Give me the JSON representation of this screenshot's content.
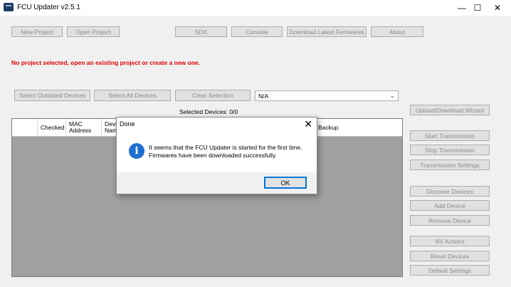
{
  "window": {
    "title": "FCU Updater v2.5.1",
    "minimize": "—",
    "maximize": "☐",
    "close": "✕"
  },
  "toolbar": {
    "new_project": "New Project",
    "open_project": "Open Project",
    "sdx": "SDX",
    "console": "Console",
    "download_firmwares": "Download Latest Firmwares",
    "about": "About"
  },
  "warning": "No project selected, open an existing project or create a new one.",
  "device_controls": {
    "select_outdated": "Select Outdated Devices",
    "select_all": "Select All Devices",
    "clear_selection": "Clear Selection",
    "dropdown_value": "N/A",
    "selected_devices": "Selected Devices: 0/0"
  },
  "table": {
    "headers": {
      "checked": "Checked",
      "mac_line1": "MAC",
      "mac_line2": "Address",
      "device_line1": "Devi",
      "device_line2": "Nam",
      "backup": "Backup"
    }
  },
  "right_panel": {
    "upload_wizard": "Upload/Download Wizard",
    "start_transmission": "Start Transmission",
    "stop_transmission": "Stop Transmission",
    "transmission_settings": "Transmission Settings",
    "discover_devices": "Discover Devices",
    "add_device": "Add Device",
    "remove_device": "Remove Device",
    "nv_actions": "NV Actions",
    "reset_devices": "Reset Devices",
    "default_settings": "Default Settings"
  },
  "dialog": {
    "title": "Done",
    "close": "✕",
    "icon": "i",
    "message_line1": "It seems that the FCU Updater is started for the first time.",
    "message_line2": "Firmwares have been downloaded successfully.",
    "ok": "OK"
  },
  "colors": {
    "warning": "#e00000",
    "info_icon": "#1e6fd0",
    "focus_border": "#0078d7",
    "grid_bg": "#a0a0a0"
  }
}
